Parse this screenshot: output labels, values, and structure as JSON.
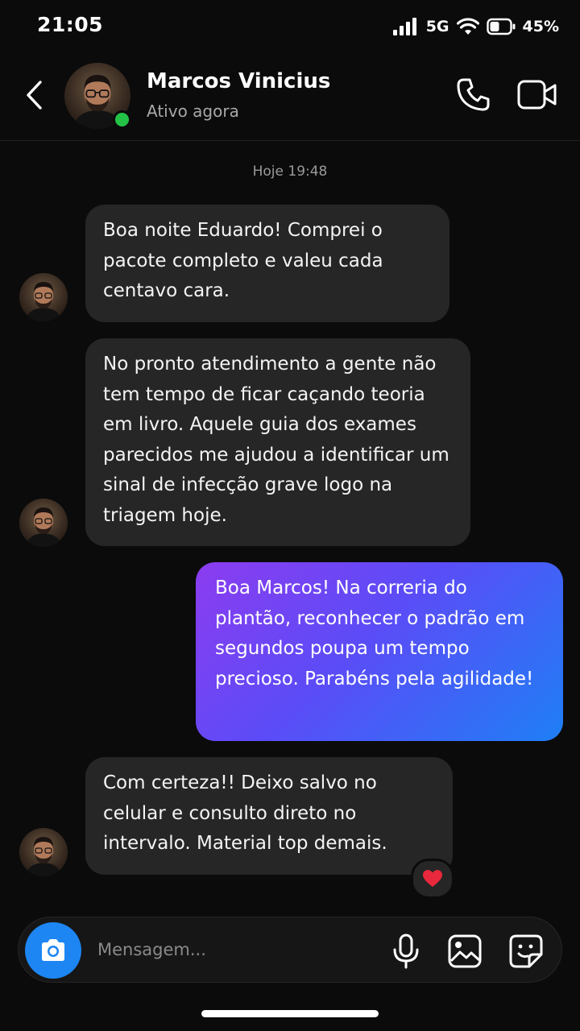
{
  "status_bar": {
    "time": "21:05",
    "network": "5G",
    "battery_percent": "45%",
    "battery_level": 0.45,
    "icons": [
      "signal-icon",
      "wifi-icon",
      "battery-icon"
    ]
  },
  "header": {
    "contact_name": "Marcos Vinicius",
    "contact_status": "Ativo agora",
    "icons": [
      "back-icon",
      "phone-icon",
      "video-camera-icon"
    ]
  },
  "conversation": {
    "timestamp": "Hoje 19:48",
    "messages": [
      {
        "direction": "incoming",
        "text": "Boa noite Eduardo! Comprei o pacote completo e valeu cada centavo cara."
      },
      {
        "direction": "incoming",
        "text": "No pronto atendimento a gente não tem tempo de ficar caçando teoria em livro. Aquele guia dos exames parecidos me ajudou a identificar um sinal de infecção grave logo na triagem hoje."
      },
      {
        "direction": "outgoing",
        "text": "Boa Marcos! Na correria do plantão, reconhecer o padrão em segundos poupa um tempo precioso. Parabéns pela agilidade!"
      },
      {
        "direction": "incoming",
        "text": "Com certeza!! Deixo salvo no celular e consulto direto no intervalo. Material top demais.",
        "reaction": "heart-icon"
      }
    ]
  },
  "composer": {
    "placeholder": "Mensagem...",
    "value": "",
    "icons": [
      "camera-icon",
      "microphone-icon",
      "gallery-icon",
      "sticker-icon"
    ]
  },
  "colors": {
    "background": "#0b0b0b",
    "incoming_bubble": "#262626",
    "outgoing_gradient_start": "#8c3cf0",
    "outgoing_gradient_end": "#1e7ff6",
    "online": "#23c247",
    "camera_button": "#1d86f2",
    "reaction_heart": "#e8283c"
  }
}
